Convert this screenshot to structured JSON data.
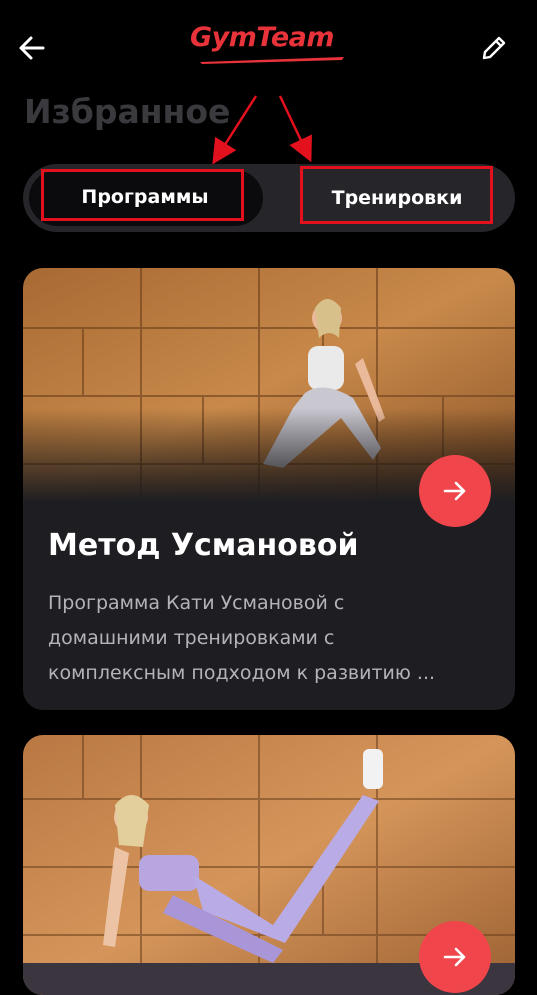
{
  "header": {
    "logo_text": "GymTeam",
    "back_icon": "arrow-left-icon",
    "edit_icon": "pencil-icon"
  },
  "page": {
    "title": "Избранное"
  },
  "tabs": [
    {
      "label": "Программы",
      "active": true
    },
    {
      "label": "Тренировки",
      "active": false
    }
  ],
  "cards": [
    {
      "title": "Метод Усмановой",
      "description_lines": [
        "Программа Кати Усмановой с",
        "домашними тренировками с",
        "комплексным подходом к развитию ..."
      ],
      "open_icon": "arrow-right-icon"
    },
    {
      "open_icon": "arrow-right-icon"
    }
  ],
  "colors": {
    "accent": "#f0464b",
    "logo": "#e8333a",
    "annotation": "#e3101d",
    "background": "#000000",
    "card": "#1e1e22"
  }
}
